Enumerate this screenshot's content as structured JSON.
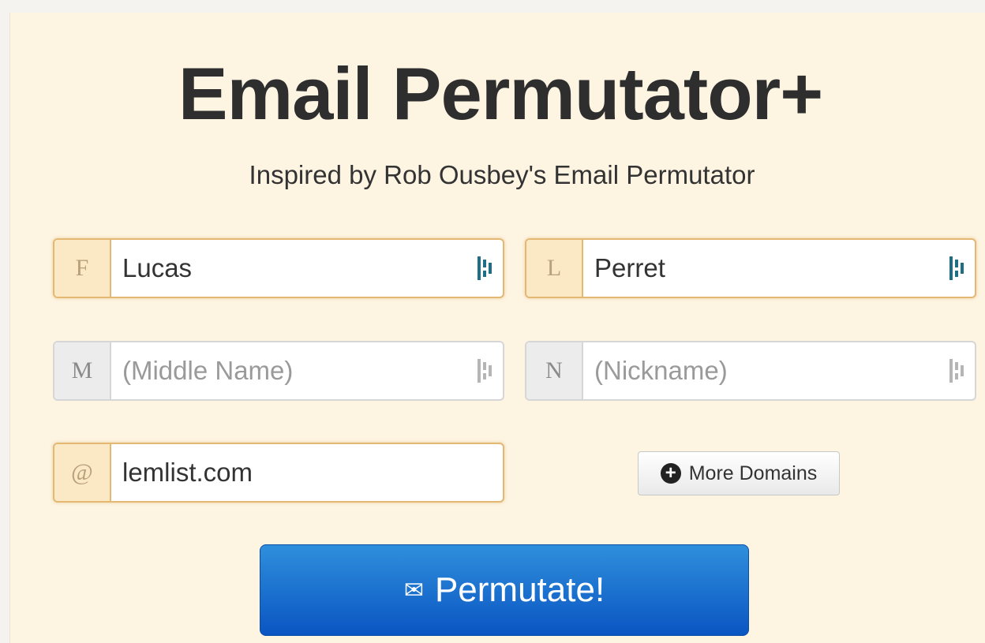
{
  "header": {
    "title": "Email Permutator+",
    "subtitle": "Inspired by Rob Ousbey's Email Permutator"
  },
  "fields": {
    "first": {
      "prefix": "F",
      "value": "Lucas"
    },
    "last": {
      "prefix": "L",
      "value": "Perret"
    },
    "middle": {
      "prefix": "M",
      "placeholder": "(Middle Name)"
    },
    "nickname": {
      "prefix": "N",
      "placeholder": "(Nickname)"
    },
    "domain": {
      "prefix": "@",
      "value": "lemlist.com"
    }
  },
  "buttons": {
    "more_domains": "More Domains",
    "permutate": "Permutate!"
  },
  "icons": {
    "field_extension": "password-manager-icon",
    "more_domains": "plus-circle-icon",
    "permutate": "envelope-icon"
  },
  "colors": {
    "panel_bg": "#fdf4e2",
    "active_border": "#e2b873",
    "primary_button": "#1a6fd0",
    "ext_icon_active": "#1f6e86",
    "ext_icon_idle": "#b5b5b5"
  }
}
